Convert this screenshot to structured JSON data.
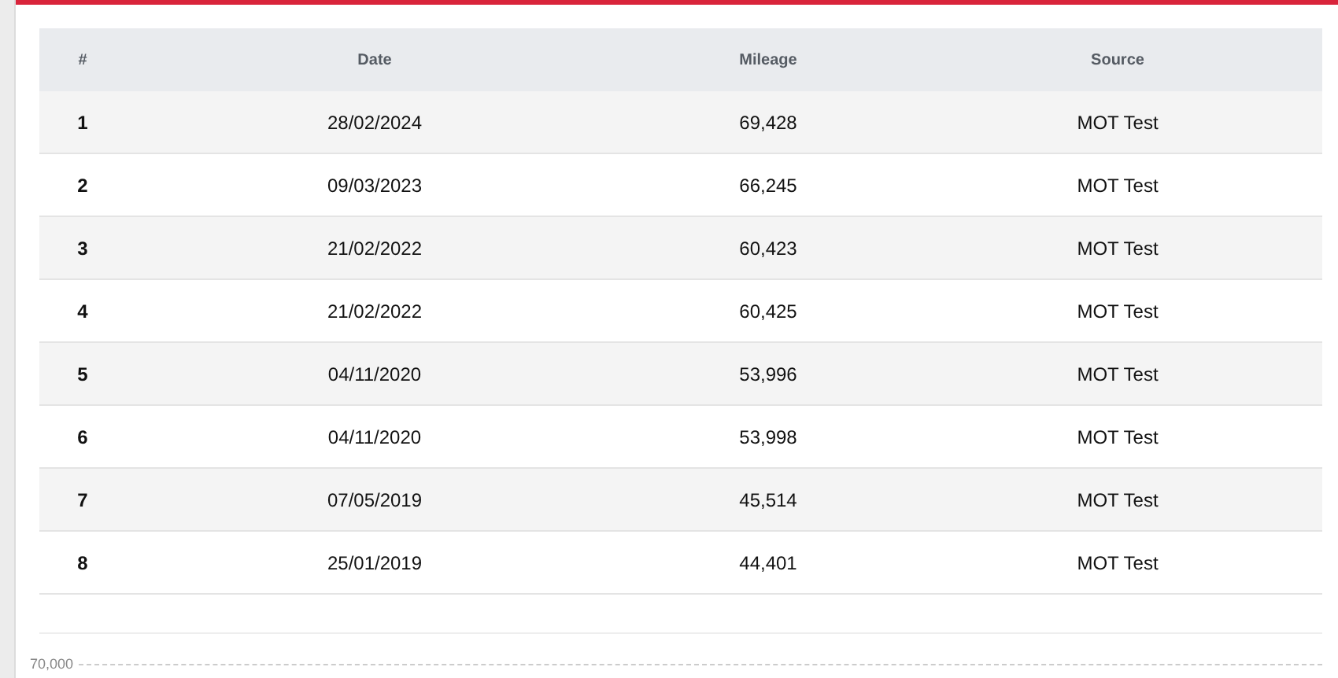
{
  "table": {
    "columns": [
      "#",
      "Date",
      "Mileage",
      "Source"
    ],
    "rows": [
      {
        "index": "1",
        "date": "28/02/2024",
        "mileage": "69,428",
        "source": "MOT Test"
      },
      {
        "index": "2",
        "date": "09/03/2023",
        "mileage": "66,245",
        "source": "MOT Test"
      },
      {
        "index": "3",
        "date": "21/02/2022",
        "mileage": "60,423",
        "source": "MOT Test"
      },
      {
        "index": "4",
        "date": "21/02/2022",
        "mileage": "60,425",
        "source": "MOT Test"
      },
      {
        "index": "5",
        "date": "04/11/2020",
        "mileage": "53,996",
        "source": "MOT Test"
      },
      {
        "index": "6",
        "date": "04/11/2020",
        "mileage": "53,998",
        "source": "MOT Test"
      },
      {
        "index": "7",
        "date": "07/05/2019",
        "mileage": "45,514",
        "source": "MOT Test"
      },
      {
        "index": "8",
        "date": "25/01/2019",
        "mileage": "44,401",
        "source": "MOT Test"
      }
    ]
  },
  "chart": {
    "y_tick_label": "70,000"
  }
}
